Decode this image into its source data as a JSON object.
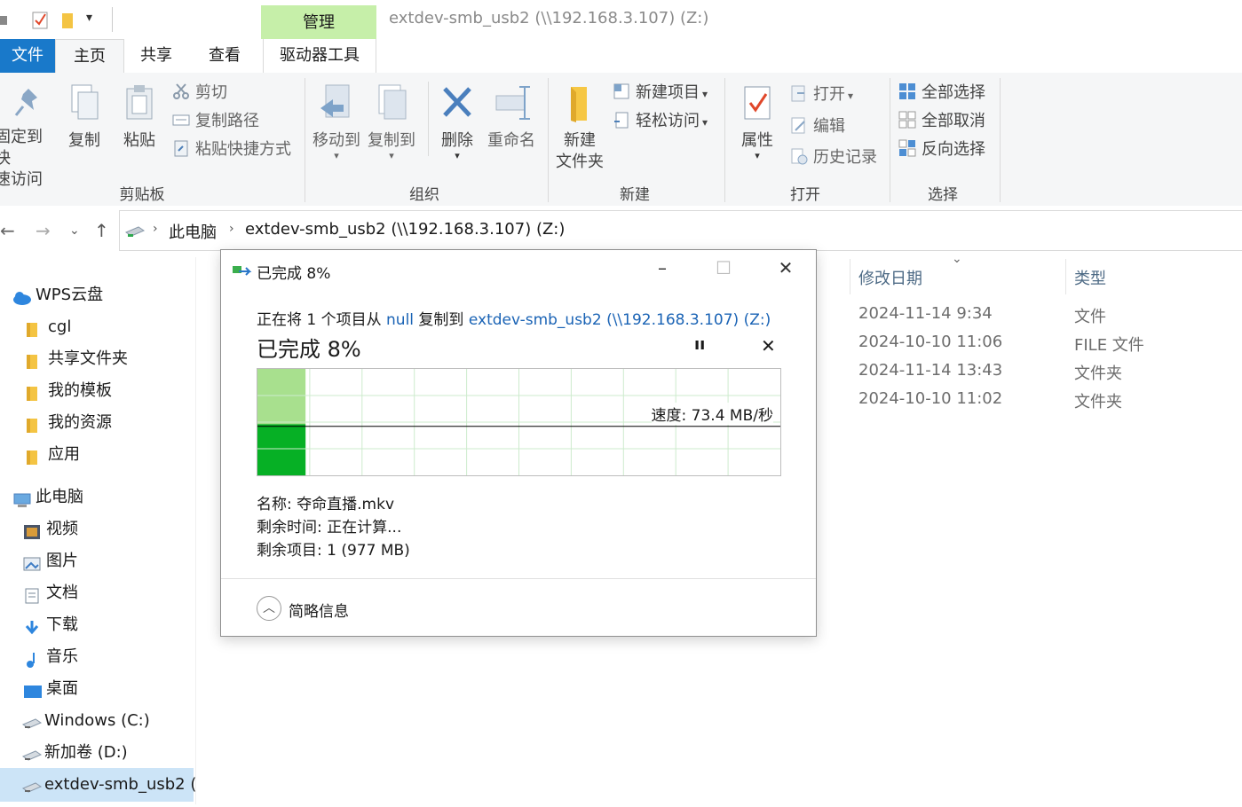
{
  "window": {
    "title": "extdev-smb_usb2 (\\\\192.168.3.107) (Z:)",
    "context_tab": "管理"
  },
  "tabs": {
    "file": "文件",
    "home": "主页",
    "share": "共享",
    "view": "查看",
    "drive_tools": "驱动器工具"
  },
  "ribbon": {
    "clipboard": {
      "pin_line1": "固定到快",
      "pin_line2": "速访问",
      "copy": "复制",
      "paste": "粘贴",
      "cut": "剪切",
      "copy_path": "复制路径",
      "paste_shortcut": "粘贴快捷方式",
      "label": "剪贴板"
    },
    "organize": {
      "move_to": "移动到",
      "copy_to": "复制到",
      "delete": "删除",
      "rename": "重命名",
      "label": "组织"
    },
    "new": {
      "new_item": "新建项目",
      "easy_access": "轻松访问",
      "new_folder_line1": "新建",
      "new_folder_line2": "文件夹",
      "label": "新建"
    },
    "open": {
      "properties": "属性",
      "open": "打开",
      "edit": "编辑",
      "history": "历史记录",
      "label": "打开"
    },
    "select": {
      "select_all": "全部选择",
      "select_none": "全部取消",
      "invert": "反向选择",
      "label": "选择"
    }
  },
  "address": {
    "segments": [
      "此电脑",
      "extdev-smb_usb2 (\\\\192.168.3.107) (Z:)"
    ]
  },
  "sidebar": {
    "items": [
      {
        "label": "WPS云盘",
        "icon": "cloud-icon"
      },
      {
        "label": "cgl",
        "icon": "folder-user-icon"
      },
      {
        "label": "共享文件夹",
        "icon": "folder-shared-icon"
      },
      {
        "label": "我的模板",
        "icon": "folder-icon"
      },
      {
        "label": "我的资源",
        "icon": "folder-icon"
      },
      {
        "label": "应用",
        "icon": "folder-apps-icon"
      },
      {
        "label": "此电脑",
        "icon": "computer-icon"
      },
      {
        "label": "视频",
        "icon": "video-icon"
      },
      {
        "label": "图片",
        "icon": "picture-icon"
      },
      {
        "label": "文档",
        "icon": "document-icon"
      },
      {
        "label": "下载",
        "icon": "download-icon"
      },
      {
        "label": "音乐",
        "icon": "music-icon"
      },
      {
        "label": "桌面",
        "icon": "desktop-icon"
      },
      {
        "label": "Windows (C:)",
        "icon": "drive-windows-icon"
      },
      {
        "label": "新加卷 (D:)",
        "icon": "drive-icon"
      },
      {
        "label": "extdev-smb_usb2 (",
        "icon": "network-drive-icon"
      }
    ]
  },
  "file_list": {
    "columns": {
      "date": "修改日期",
      "type": "类型"
    },
    "rows": [
      {
        "date": "2024-11-14 9:34",
        "type": "文件"
      },
      {
        "date": "2024-10-10 11:06",
        "type": "FILE 文件"
      },
      {
        "date": "2024-11-14 13:43",
        "type": "文件夹"
      },
      {
        "date": "2024-10-10 11:02",
        "type": "文件夹"
      }
    ]
  },
  "dialog": {
    "title": "已完成 8%",
    "desc_prefix": "正在将 1 个项目从 ",
    "source": "null",
    "desc_mid": " 复制到 ",
    "dest": "extdev-smb_usb2 (\\\\192.168.3.107) (Z:)",
    "big_status": "已完成 8%",
    "progress_percent": 8,
    "speed": "速度: 73.4 MB/秒",
    "name_label": "名称:",
    "name_value": "夺命直播.mkv",
    "time_label": "剩余时间:",
    "time_value": "正在计算...",
    "items_label": "剩余项目:",
    "items_value": "1 (977 MB)",
    "details_toggle": "简略信息",
    "colors": {
      "done_fill": "#06b025",
      "done_light": "#a8e08e",
      "grid": "#cdebcd"
    }
  }
}
